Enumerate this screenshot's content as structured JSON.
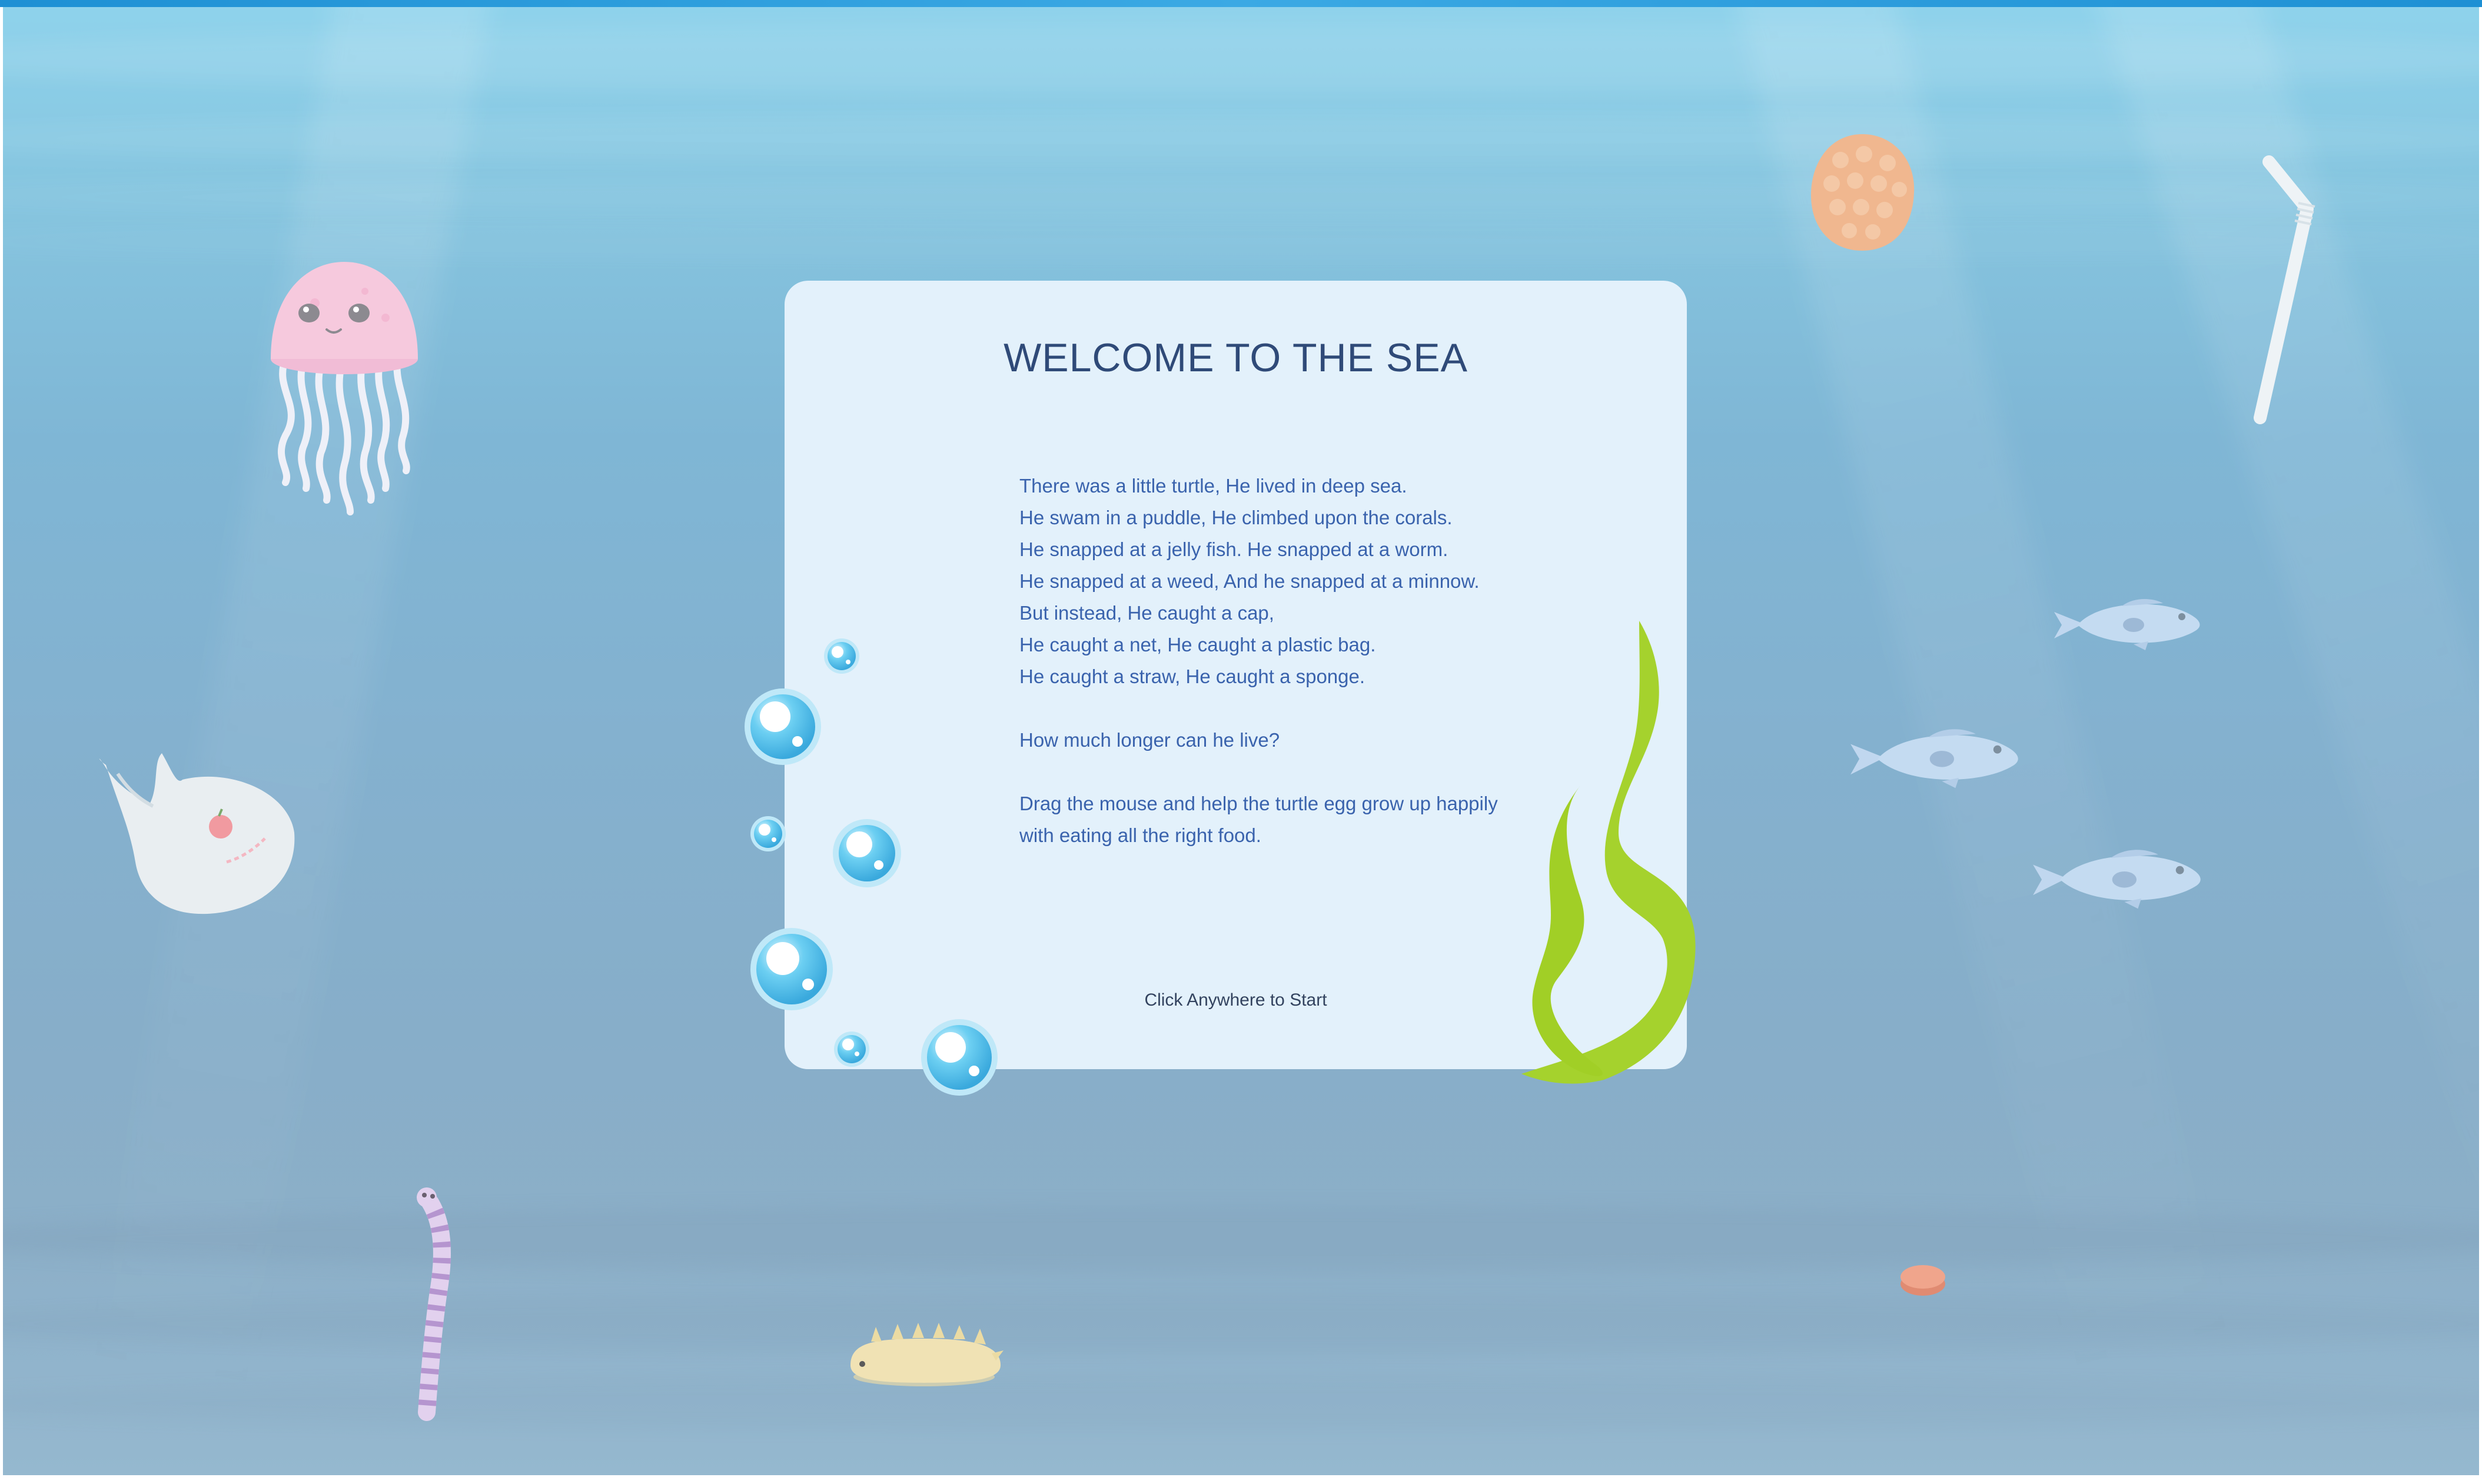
{
  "intro": {
    "title": "WELCOME TO THE SEA",
    "story_lines": [
      "There was a little turtle, He lived in deep sea.",
      "He swam in a puddle, He climbed upon the corals.",
      "He snapped at a jelly fish. He snapped at a worm.",
      "He snapped at a weed, And he snapped at a minnow.",
      "But instead, He caught a cap,",
      "He caught a net, He caught a plastic bag.",
      "He caught a straw, He caught a sponge."
    ],
    "question": "How much longer can he live?",
    "instructions": [
      "Drag the mouse and help the turtle egg grow up happily",
      "with eating all the right food."
    ],
    "start_hint": "Click Anywhere to Start"
  },
  "scene": {
    "sprites": [
      "jellyfish",
      "plastic-bag",
      "sponge",
      "drinking-straw",
      "fish",
      "fish",
      "fish",
      "seaweed",
      "bubbles",
      "sea-worm",
      "sea-slug",
      "bottle-cap"
    ],
    "colors": {
      "water_top": "#8fd3ec",
      "water_bottom": "#95b8cf",
      "card": "#e3f1fb",
      "title": "#2f4a78",
      "story_text": "#3a63ad",
      "seaweed": "#a5d22d",
      "bubble": "#4bbce8"
    }
  }
}
